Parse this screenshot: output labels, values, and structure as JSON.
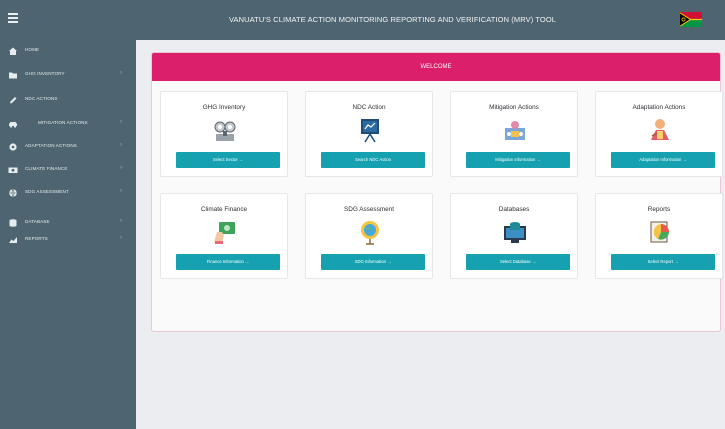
{
  "header": {
    "title": "VANUATU'S CLIMATE ACTION MONITORING REPORTING AND VERIFICATION (MRV) TOOL",
    "menu_icon": "hamburger-icon",
    "flag_icon": "vanuatu-flag-icon"
  },
  "sidebar": {
    "items": [
      {
        "label": "HOME",
        "icon": "home-icon"
      },
      {
        "label": "GHG INVENTORY",
        "icon": "folder-icon"
      },
      {
        "label": "NDC ACTIONS",
        "icon": "pencil-icon"
      },
      {
        "label": "MITIGATION ACTIONS",
        "icon": "car-icon"
      },
      {
        "label": "ADAPTATION ACTIONS",
        "icon": "gear-icon"
      },
      {
        "label": "CLIMATE FINANCE",
        "icon": "money-icon"
      },
      {
        "label": "SDG ASSESSMENT",
        "icon": "globe-icon"
      },
      {
        "label": "DATABASE",
        "icon": "database-icon"
      },
      {
        "label": "REPORTS",
        "icon": "chart-icon"
      }
    ]
  },
  "main": {
    "welcome": "WELCOME",
    "cards": [
      {
        "title": "GHG Inventory",
        "button": "Select Sector →",
        "icon": "ghg-inventory-icon"
      },
      {
        "title": "NDC Action",
        "button": "Search NDC Action",
        "icon": "ndc-action-icon"
      },
      {
        "title": "Mitigation Actions",
        "button": "Mitigation Information →",
        "icon": "mitigation-actions-icon"
      },
      {
        "title": "Adaptation Actions",
        "button": "Adaptation Information →",
        "icon": "adaptation-actions-icon"
      },
      {
        "title": "Climate Finance",
        "button": "Finance Information →",
        "icon": "climate-finance-icon"
      },
      {
        "title": "SDG Assessment",
        "button": "SDG Information →",
        "icon": "sdg-assessment-icon"
      },
      {
        "title": "Databases",
        "button": "Select Database →",
        "icon": "databases-icon"
      },
      {
        "title": "Reports",
        "button": "Select Report →",
        "icon": "reports-icon"
      }
    ]
  },
  "colors": {
    "sidebar": "#4e6470",
    "welcome_bar": "#dc1f6b",
    "button": "#16a1b0",
    "background": "#ecedf0"
  }
}
